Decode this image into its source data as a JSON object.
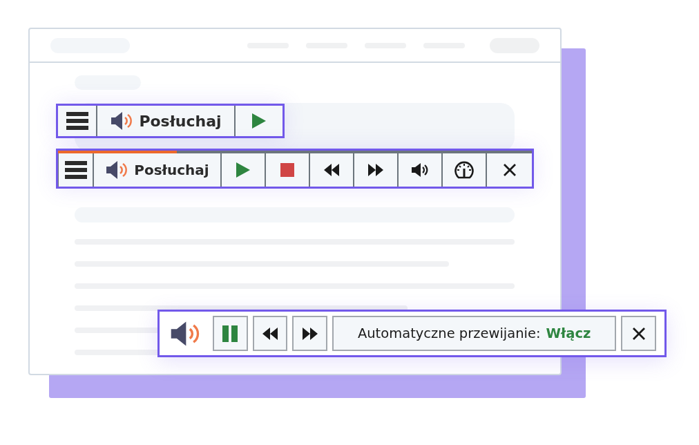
{
  "toolbars": [
    {
      "kind": "compact",
      "buttons": [
        {
          "kind": "menu"
        },
        {
          "kind": "listen",
          "label": "Posłuchaj"
        },
        {
          "kind": "play"
        }
      ]
    },
    {
      "kind": "full",
      "progress": {
        "level": 0.25
      },
      "buttons": [
        {
          "kind": "menu"
        },
        {
          "kind": "listen",
          "label": "Posłuchaj"
        },
        {
          "kind": "play"
        },
        {
          "kind": "stop"
        },
        {
          "kind": "rewind"
        },
        {
          "kind": "forward"
        },
        {
          "kind": "volume"
        },
        {
          "kind": "speed"
        },
        {
          "kind": "close"
        }
      ]
    },
    {
      "kind": "floating",
      "buttons": [
        {
          "kind": "speaker"
        },
        {
          "kind": "pause"
        },
        {
          "kind": "rewind"
        },
        {
          "kind": "forward"
        },
        {
          "kind": "auto",
          "label": "Automatyczne przewijanie: **Włącz**"
        },
        {
          "kind": "close"
        }
      ]
    }
  ]
}
